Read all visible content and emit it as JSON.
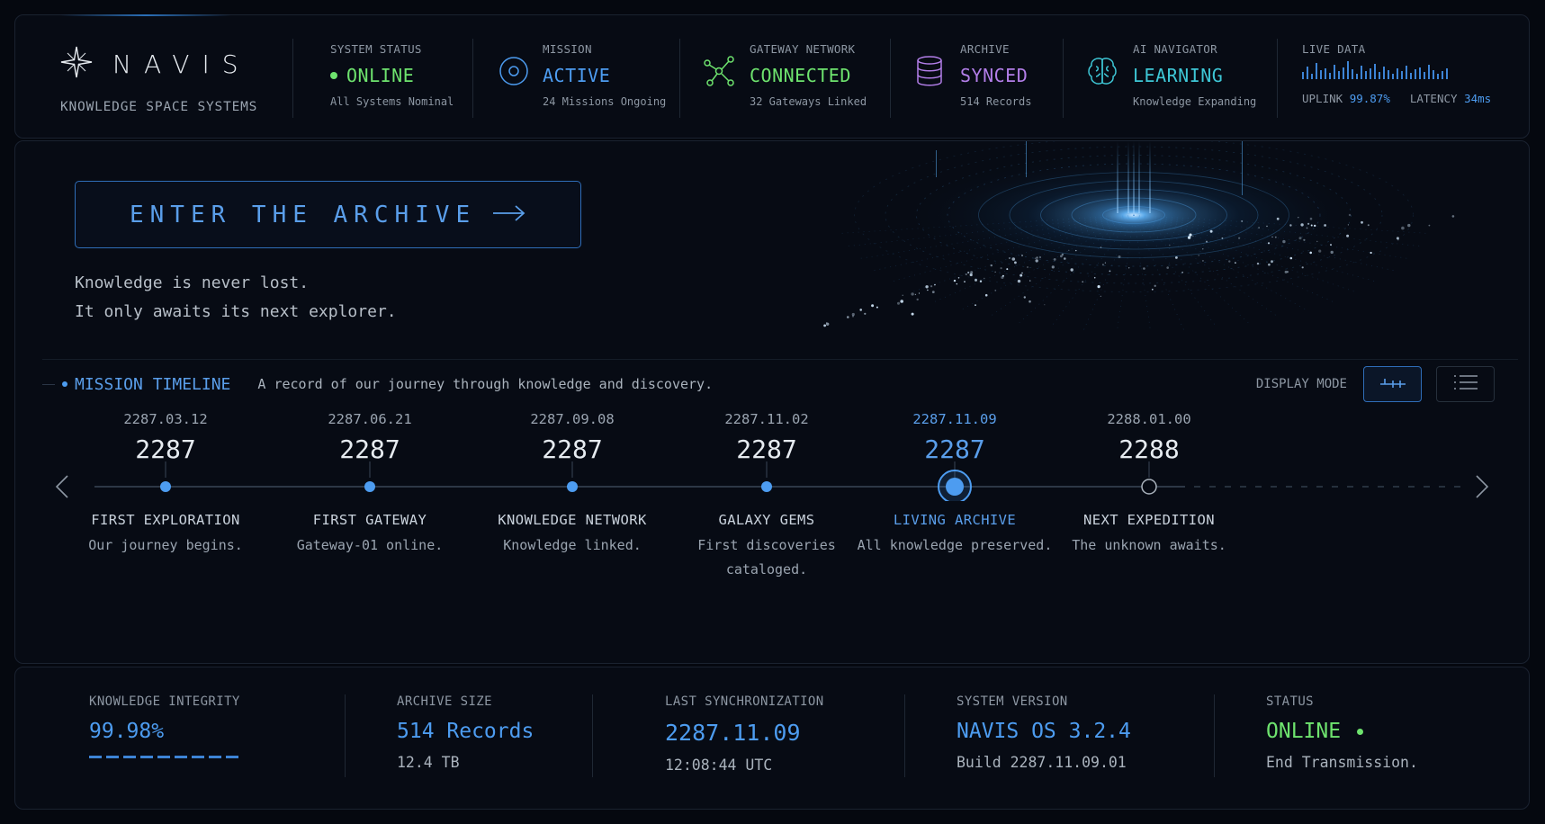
{
  "brand": {
    "name": "NAVIS",
    "subtitle": "KNOWLEDGE SPACE SYSTEMS"
  },
  "status_items": [
    {
      "label": "SYSTEM STATUS",
      "value": "ONLINE",
      "sub": "All Systems Nominal",
      "color": "#6ee36e",
      "icon": "status-dot"
    },
    {
      "label": "MISSION",
      "value": "ACTIVE",
      "sub": "24 Missions Ongoing",
      "color": "#4d9cf0",
      "icon": "target-icon"
    },
    {
      "label": "GATEWAY NETWORK",
      "value": "CONNECTED",
      "sub": "32 Gateways Linked",
      "color": "#6ee36e",
      "icon": "network-icon"
    },
    {
      "label": "ARCHIVE",
      "value": "SYNCED",
      "sub": "514 Records",
      "color": "#b27ee8",
      "icon": "database-icon"
    },
    {
      "label": "AI NAVIGATOR",
      "value": "LEARNING",
      "sub": "Knowledge Expanding",
      "color": "#3ec7d6",
      "icon": "brain-icon"
    }
  ],
  "live_data": {
    "label": "LIVE DATA",
    "uplink_label": "UPLINK",
    "uplink_value": "99.87%",
    "latency_label": "LATENCY",
    "latency_value": "34ms",
    "accent": "#4d9cf0"
  },
  "hero": {
    "cta_label": "ENTER THE ARCHIVE",
    "tagline_1": "Knowledge is never lost.",
    "tagline_2": "It only awaits its next explorer."
  },
  "timeline": {
    "title": "MISSION TIMELINE",
    "description": "A record of our journey through knowledge and discovery.",
    "display_mode_label": "DISPLAY MODE",
    "events": [
      {
        "date": "2287.03.12",
        "year": "2287",
        "name": "FIRST EXPLORATION",
        "desc": "Our journey begins.",
        "state": "past"
      },
      {
        "date": "2287.06.21",
        "year": "2287",
        "name": "FIRST GATEWAY",
        "desc": "Gateway-01 online.",
        "state": "past"
      },
      {
        "date": "2287.09.08",
        "year": "2287",
        "name": "KNOWLEDGE NETWORK",
        "desc": "Knowledge linked.",
        "state": "past"
      },
      {
        "date": "2287.11.02",
        "year": "2287",
        "name": "GALAXY GEMS",
        "desc": "First discoveries cataloged.",
        "state": "past"
      },
      {
        "date": "2287.11.09",
        "year": "2287",
        "name": "LIVING ARCHIVE",
        "desc": "All knowledge preserved.",
        "state": "active"
      },
      {
        "date": "2288.01.00",
        "year": "2288",
        "name": "NEXT EXPEDITION",
        "desc": "The unknown awaits.",
        "state": "future"
      }
    ]
  },
  "footer": [
    {
      "label": "KNOWLEDGE INTEGRITY",
      "value": "99.98%",
      "sub": "",
      "color": "#4d9cf0"
    },
    {
      "label": "ARCHIVE SIZE",
      "value": "514 Records",
      "sub": "12.4 TB",
      "color": "#4d9cf0"
    },
    {
      "label": "LAST SYNCHRONIZATION",
      "value": "2287.11.09",
      "sub": "12:08:44 UTC",
      "color": "#4d9cf0"
    },
    {
      "label": "SYSTEM VERSION",
      "value": "NAVIS OS 3.2.4",
      "sub": "Build 2287.11.09.01",
      "color": "#4d9cf0"
    },
    {
      "label": "STATUS",
      "value": "ONLINE",
      "sub": "End Transmission.",
      "color": "#6ee36e"
    }
  ]
}
